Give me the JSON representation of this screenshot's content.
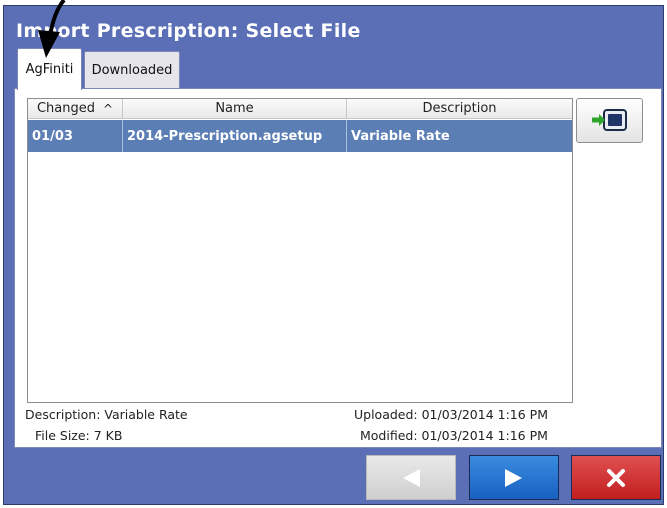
{
  "window": {
    "title": "Import Prescription: Select File"
  },
  "tabs": [
    {
      "label": "AgFiniti",
      "selected": true
    },
    {
      "label": "Downloaded",
      "selected": false
    }
  ],
  "table": {
    "columns": [
      "Changed",
      "Name",
      "Description"
    ],
    "sort_indicator": "^",
    "rows": [
      {
        "changed": "01/03",
        "name": "2014-Prescription.agsetup",
        "description": "Variable Rate",
        "selected": true
      }
    ]
  },
  "details": {
    "description": "Description: Variable Rate",
    "file_size": "File Size: 7 KB",
    "uploaded": "Uploaded: 01/03/2014 1:16 PM",
    "modified": "Modified: 01/03/2014 1:16 PM"
  },
  "icons": {
    "import": "import-to-display-icon",
    "back": "back-arrow-icon",
    "next": "next-arrow-icon",
    "cancel": "close-x-icon",
    "annotation": "pointer-arrow-icon"
  },
  "colors": {
    "window_bg": "#5a6fb6",
    "selected_row": "#5b7eb5",
    "next_button": "#1f6fd0",
    "cancel_button": "#d03030",
    "back_button_disabled": "#dcdcdc"
  },
  "nav": {
    "back_enabled": false,
    "next_enabled": true
  }
}
